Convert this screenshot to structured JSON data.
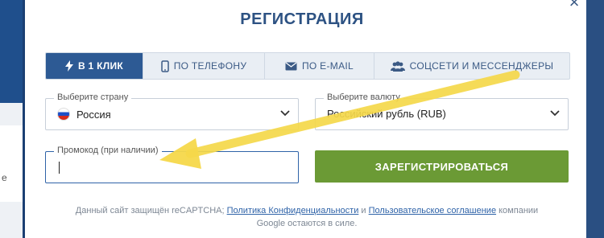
{
  "background": {
    "side_text": "e"
  },
  "modal": {
    "title": "РЕГИСТРАЦИЯ",
    "close_label": "×"
  },
  "tabs": [
    {
      "label": "В 1 КЛИК",
      "icon": "lightning-icon",
      "active": true
    },
    {
      "label": "ПО ТЕЛЕФОНУ",
      "icon": "phone-icon",
      "active": false
    },
    {
      "label": "ПО E-MAIL",
      "icon": "envelope-icon",
      "active": false
    },
    {
      "label": "СОЦСЕТИ И МЕССЕНДЖЕРЫ",
      "icon": "users-icon",
      "active": false
    }
  ],
  "country": {
    "label": "Выберите страну",
    "value": "Россия",
    "flag": "russia-flag-icon"
  },
  "currency": {
    "label": "Выберите валюту",
    "value": "Российский рубль (RUB)"
  },
  "promo": {
    "label": "Промокод (при наличии)",
    "value": ""
  },
  "register_button": "ЗАРЕГИСТРИРОВАТЬСЯ",
  "legal": {
    "prefix": "Данный сайт защищён reCAPTCHA;",
    "privacy_link": "Политика Конфиденциальности",
    "and": "и",
    "terms_link": "Пользовательское соглашение",
    "suffix_line1": "компании",
    "line2": "Google остаются в силе."
  },
  "colors": {
    "accent": "#2d5a94",
    "button_green": "#6b9a35",
    "arrow_yellow": "#f5d84a"
  }
}
